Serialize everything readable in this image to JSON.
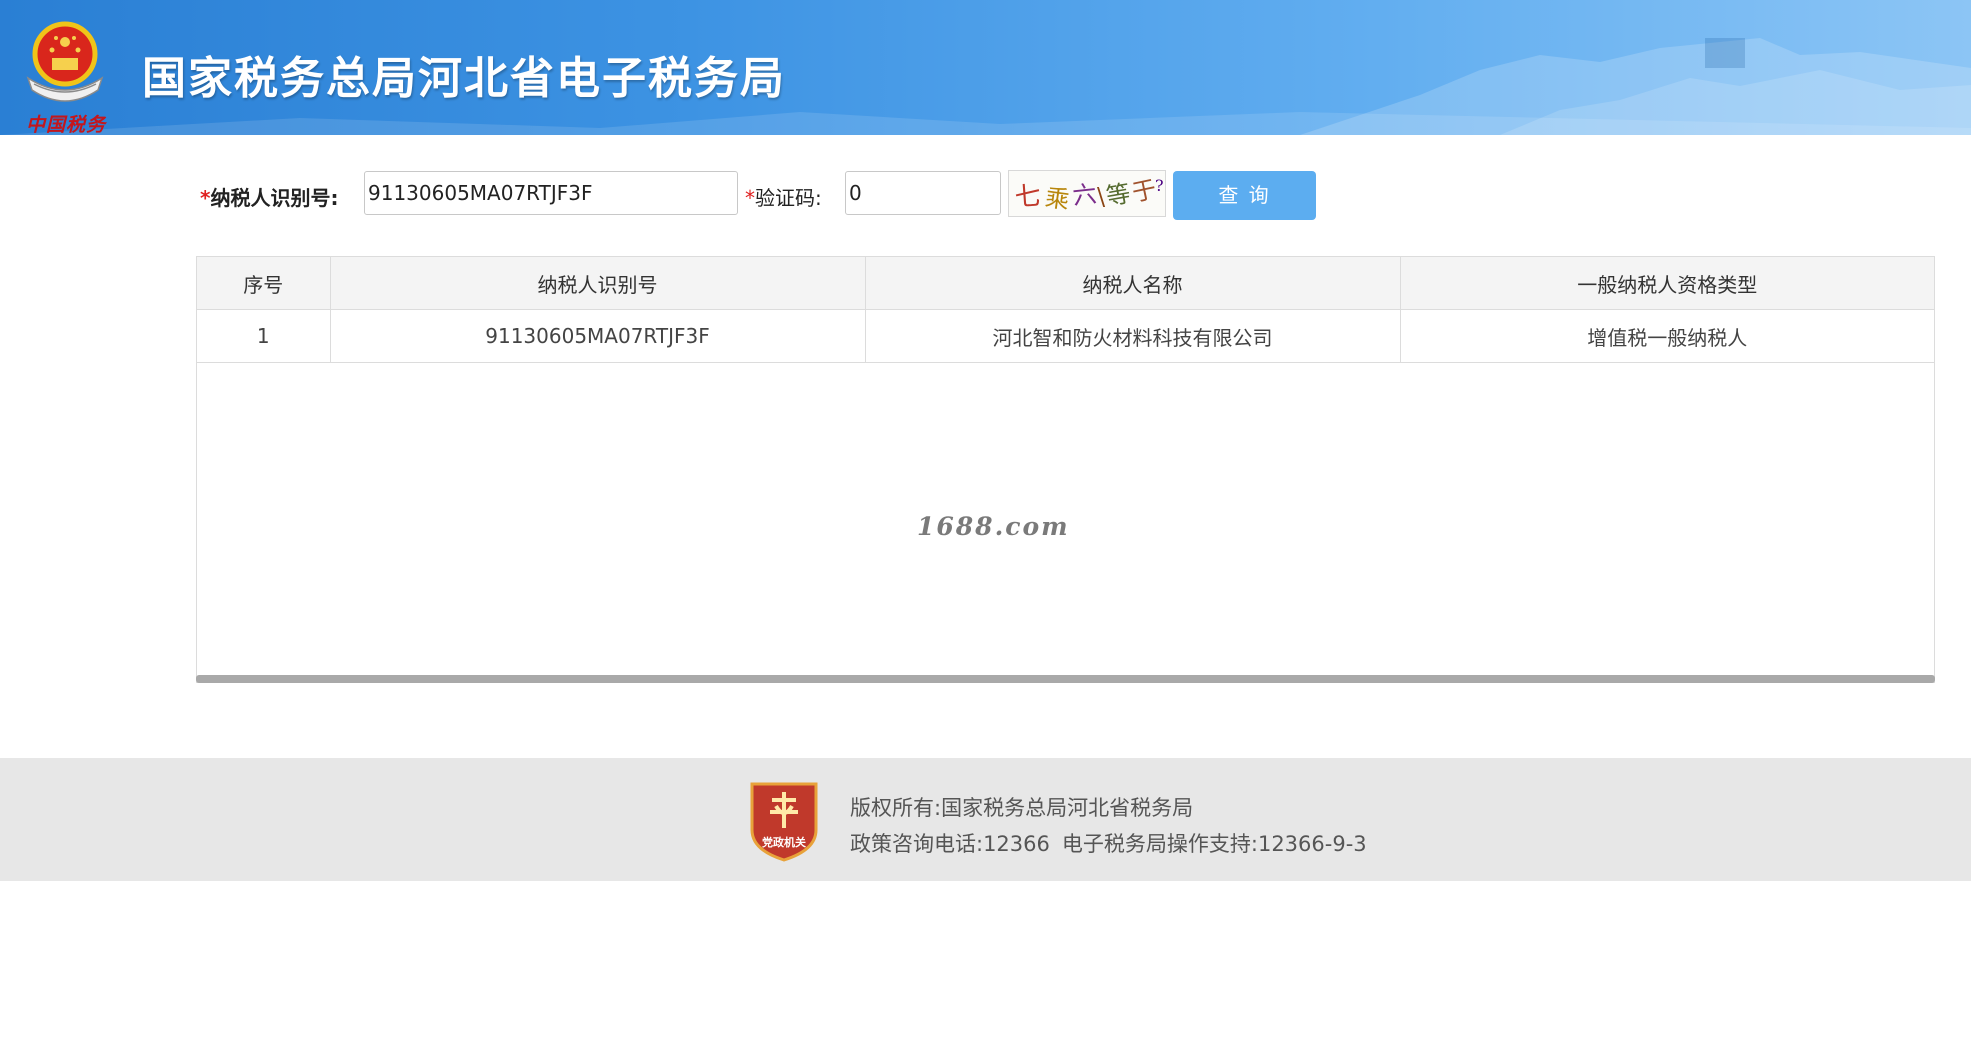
{
  "header": {
    "site_title": "国家税务总局河北省电子税务局",
    "slogan": "中国税务",
    "emblem_icon": "national-emblem-icon"
  },
  "form": {
    "taxid_required_mark": "*",
    "taxid_label": "纳税人识别号:",
    "taxid_value": "91130605MA07RTJF3F",
    "captcha_required_mark": "*",
    "captcha_label": "验证码:",
    "captcha_value": "0",
    "captcha_image_text": "七乘六\\等于?",
    "query_button": "查 询"
  },
  "table": {
    "headers": [
      "序号",
      "纳税人识别号",
      "纳税人名称",
      "一般纳税人资格类型"
    ],
    "rows": [
      [
        "1",
        "91130605MA07RTJF3F",
        "河北智和防火材料科技有限公司",
        "增值税一般纳税人"
      ]
    ]
  },
  "watermark": "1688.com",
  "footer": {
    "copyright": "版权所有:国家税务总局河北省税务局",
    "hotline": "政策咨询电话:12366",
    "support": "电子税务局操作支持:12366-9-3",
    "logo_icon": "party-government-badge-icon",
    "logo_text": "党政机关"
  },
  "colors": {
    "banner_blue": "#3d93e3",
    "button_blue": "#5cadf0",
    "required_red": "#e02020",
    "footer_bg": "#e7e7e7"
  }
}
